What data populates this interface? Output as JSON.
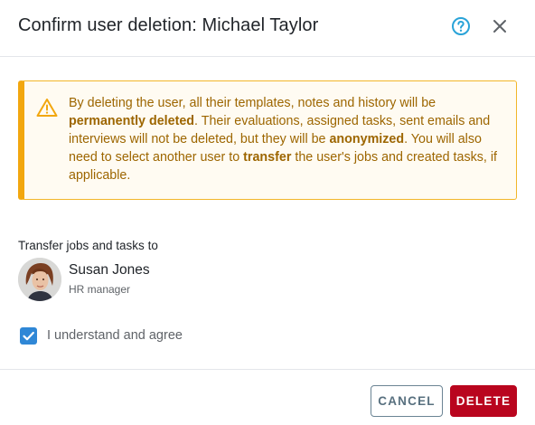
{
  "dialog": {
    "title": "Confirm user deletion: Michael Taylor"
  },
  "warning": {
    "segments": [
      {
        "text": "By deleting the user, all their templates, notes and history will be ",
        "bold": false
      },
      {
        "text": "permanently deleted",
        "bold": true
      },
      {
        "text": ". Their evaluations, assigned tasks, sent emails and interviews will not be deleted, but they will be ",
        "bold": false
      },
      {
        "text": "anonymized",
        "bold": true
      },
      {
        "text": ". You will also need to select another user to ",
        "bold": false
      },
      {
        "text": "transfer",
        "bold": true
      },
      {
        "text": " the user's jobs and created tasks, if applicable.",
        "bold": false
      }
    ]
  },
  "transfer": {
    "label": "Transfer jobs and tasks to",
    "user_name": "Susan Jones",
    "user_role": "HR manager"
  },
  "agree": {
    "label": "I understand and agree",
    "checked": true
  },
  "buttons": {
    "cancel": "CANCEL",
    "delete": "DELETE"
  },
  "colors": {
    "warning_text": "#9d6600",
    "warning_border": "#f2a70f",
    "checkbox": "#2f87d6",
    "delete_bg": "#b9051e",
    "help_icon": "#29a3d8"
  },
  "icons": {
    "help": "help-circle-icon",
    "close": "close-icon",
    "warning": "warning-triangle-icon",
    "check": "checkmark-icon"
  }
}
